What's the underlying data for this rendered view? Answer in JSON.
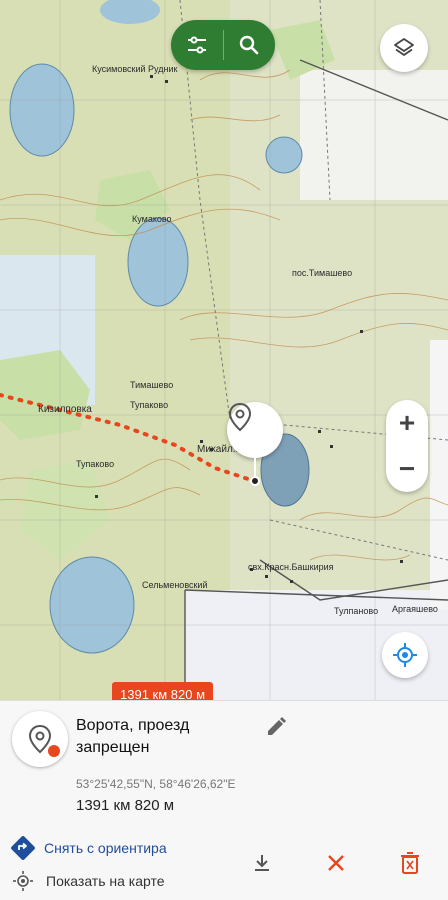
{
  "map": {
    "place_labels": [
      "Кусимовский Рудник",
      "Тупаково",
      "Михайл...",
      "свх.Красн.Башкирия",
      "Сельменовский",
      "Кумаково",
      "Тимашево",
      "Тупаково",
      "пос.Тимашево",
      "Тулпаново",
      "Кизилповка",
      "Аргаяшево"
    ]
  },
  "controls": {
    "filter_icon": "tune-sliders-icon",
    "search_icon": "search-icon",
    "layers_icon": "layers-icon",
    "zoom_in_label": "+",
    "zoom_out_label": "−",
    "locate_icon": "gps-fixed-icon"
  },
  "route": {
    "distance_badge": "1391 км 820 м",
    "color": "#e8461e"
  },
  "poi": {
    "title": "Ворота, проезд запрещен",
    "coordinates": "53°25'42,55\"N, 58°46'26,62\"E",
    "distance": "1391 км 820 м",
    "accent_color": "#e8461e"
  },
  "actions": {
    "remove_target_label": "Снять с ориентира",
    "show_on_map_label": "Показать на карте",
    "primary_color": "#1f4e9c"
  },
  "bottom_icons": {
    "download": "download-icon",
    "close": "close-icon",
    "delete": "delete-icon"
  }
}
